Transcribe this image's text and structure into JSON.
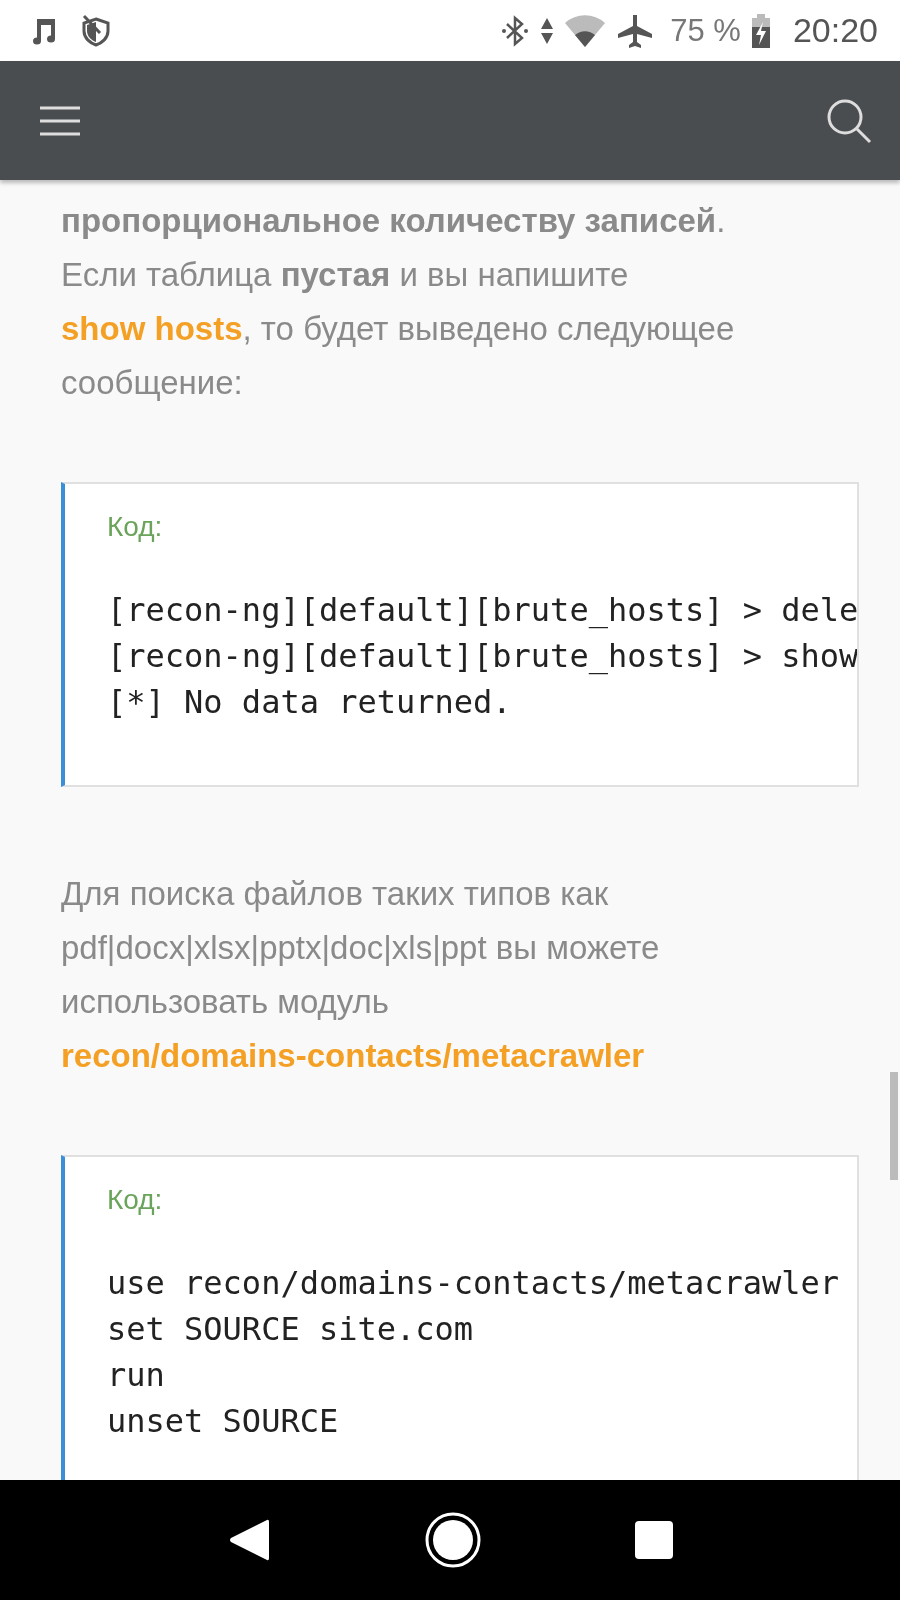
{
  "status_bar": {
    "battery": "75 %",
    "time": "20:20"
  },
  "article": [
    {
      "kind": "paragraph",
      "parts": [
        {
          "kind": "text",
          "text": "**пропорциональное количеству записей**. Если таблица **пустая** и вы напишите "
        },
        {
          "kind": "link",
          "text": "show hosts"
        },
        {
          "kind": "text",
          "text": ", то будет выведено следующее сообщение:"
        }
      ]
    },
    {
      "kind": "code",
      "label": "Код:",
      "lines": [
        "[recon-ng][default][brute_hosts] > dele",
        "[recon-ng][default][brute_hosts] > show",
        "[*] No data returned."
      ]
    },
    {
      "kind": "paragraph",
      "parts": [
        {
          "kind": "text",
          "text": "Для поиска файлов таких типов как pdf|docx|xlsx|pptx|doc|xls|ppt вы можете использовать модуль "
        },
        {
          "kind": "link",
          "text": "recon/domains-contacts/metacrawler"
        }
      ]
    },
    {
      "kind": "code",
      "label": "Код:",
      "lines": [
        "use recon/domains-contacts/metacrawler",
        "set SOURCE site.com",
        "run",
        "unset SOURCE"
      ]
    }
  ]
}
